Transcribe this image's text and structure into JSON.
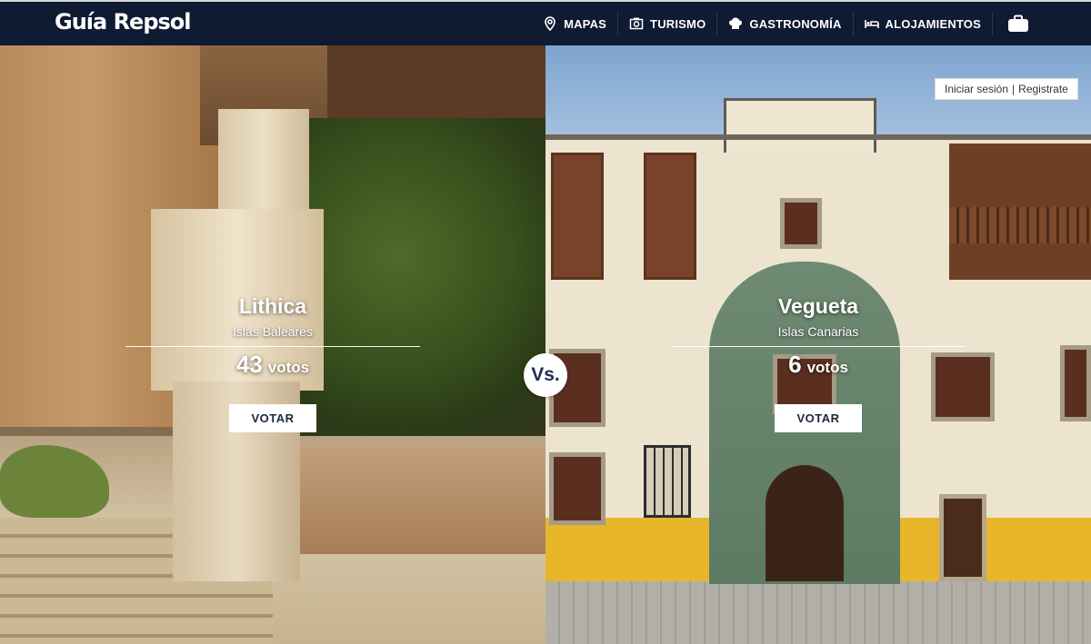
{
  "brand": {
    "logo_text": "Guía Repsol",
    "accent_color": "#e4222b",
    "nav_bg": "#0f1a33"
  },
  "nav": {
    "items": [
      {
        "label": "MAPAS",
        "icon": "map-pin-icon"
      },
      {
        "label": "TURISMO",
        "icon": "camera-icon"
      },
      {
        "label": "GASTRONOMÍA",
        "icon": "chef-hat-icon"
      },
      {
        "label": "ALOJAMIENTOS",
        "icon": "bed-icon"
      }
    ],
    "bag_icon": "briefcase-icon"
  },
  "auth": {
    "login_label": "Iniciar sesión",
    "separator": "|",
    "register_label": "Registrate"
  },
  "versus": {
    "label": "Vs."
  },
  "contest": {
    "left": {
      "name": "Lithica",
      "region": "Islas Baleares",
      "votes": "43",
      "votes_unit": "votos",
      "button": "VOTAR"
    },
    "right": {
      "name": "Vegueta",
      "region": "Islas Canarias",
      "votes": "6",
      "votes_unit": "votos",
      "button": "VOTAR"
    }
  }
}
